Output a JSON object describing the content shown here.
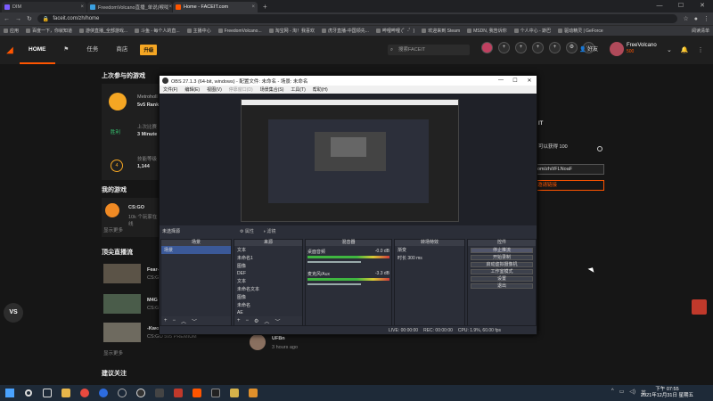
{
  "browser": {
    "tabs": [
      {
        "title": "DIM",
        "color": "#7b5cff"
      },
      {
        "title": "FreedomVolcano直播_单说(喉咙",
        "color": "#3aa0e0"
      },
      {
        "title": "Home - FACEIT.com",
        "color": "#ff5500",
        "active": true
      }
    ],
    "new_tab": "+",
    "url": "faceit.com/zh/home",
    "bookmarks": [
      "应用",
      "百度一下，你就知道",
      "游侠直播_全部游戏...",
      "斗鱼 - 每个人的直...",
      "主播中心",
      "FreedomVolcano...",
      "淘宝网 - 淘！我喜欢",
      "虎牙直播-中国领先...",
      "哔哩哔哩 (゜-゜)",
      "欢迎来到 Steam",
      "MSDN, 我告诉你",
      "个人中心 - 斯巴",
      "驱动精灵 | GeForce",
      "阅读清单"
    ]
  },
  "faceit": {
    "nav": [
      "HOME",
      "任务",
      "商店"
    ],
    "plus": "升级",
    "search_placeholder": "搜索FACEIT",
    "friends": "好友",
    "user_name": "FreeVolcano",
    "user_points": "500",
    "right_text": "可以获得 100",
    "right_link": "om/zh/i/FLNoaF",
    "right_btn": "邀请链接",
    "right_heading": "IT",
    "sections": {
      "last_played": "上次参与的游戏",
      "my_games": "我的游戏",
      "live": "顶尖直播流",
      "suggest": "建议关注"
    },
    "last": {
      "map": "Metroholl",
      "mode": "5v5 Rank",
      "result": "胜利",
      "dur_label": "上次比赛",
      "dur": "3 Minute",
      "elo_label": "技能等级",
      "elo": "1,144",
      "level": "4"
    },
    "game": {
      "name": "CS:GO",
      "sub": "10k 个玩家在线",
      "more": "显示更多"
    },
    "streams": [
      {
        "name": "Fear-",
        "game": "CS:GO"
      },
      {
        "name": "M4G",
        "game": "CS:GO"
      },
      {
        "name": "-Kwo",
        "game": "CS:GO 5v5 PREMIUM"
      }
    ],
    "stream_more": "显示更多",
    "post_user": "UFBn",
    "post_time": "3 hours ago",
    "vs": "VS"
  },
  "obs": {
    "title": "OBS 27.1.3 (64-bit, windows) - 配置文件: 未命名 - 场景: 未命名",
    "menu": [
      "文件(F)",
      "编辑(E)",
      "视图(V)",
      "停靠窗口(D)",
      "场景集合(S)",
      "工具(T)",
      "帮助(H)"
    ],
    "no_source": "未选择源",
    "props": "属性",
    "filters": "滤镜",
    "docks": {
      "scenes": "场景",
      "sources": "来源",
      "mixer": "混音器",
      "transitions": "转场特效",
      "controls": "控件"
    },
    "scenes": [
      "场景"
    ],
    "sources": [
      "文本",
      "未命名1",
      "图像",
      "DEF",
      "文本",
      "未命名文本",
      "图像",
      "未命名",
      "AE",
      "图层"
    ],
    "mixer": [
      {
        "name": "桌面音频",
        "db": "-0.0 dB"
      },
      {
        "name": "麦克风/Aux",
        "db": "-3.3 dB"
      }
    ],
    "transition": "渐变",
    "duration_label": "时长",
    "duration": "300 ms",
    "controls": [
      "停止推流",
      "开始录制",
      "启动虚拟摄像机",
      "工作室模式",
      "设置",
      "退出"
    ],
    "status": [
      "LIVE: 00:00:00",
      "REC: 00:00:00",
      "CPU: 1.9%, 60.00 fps"
    ]
  },
  "taskbar": {
    "time": "下午 07:55",
    "date": "2021年12月31日 星期五"
  },
  "colors": {
    "accent": "#ff5500",
    "obs_bg": "#2b2e38",
    "plus": "#f5a623"
  }
}
